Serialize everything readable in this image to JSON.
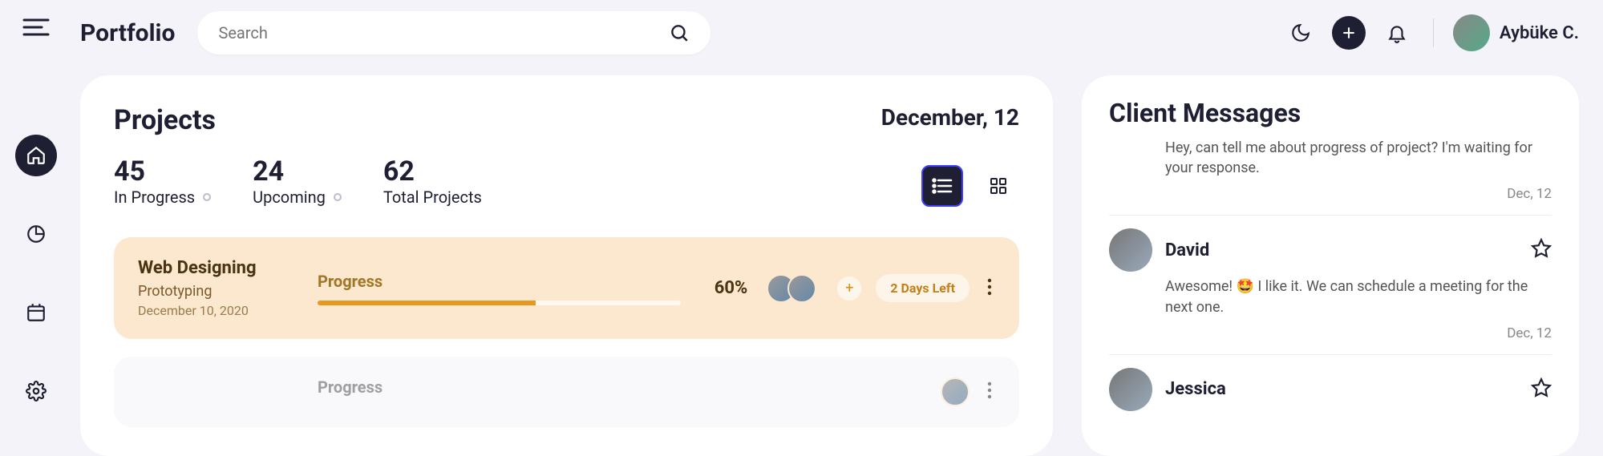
{
  "page_title": "Portfolio",
  "search_placeholder": "Search",
  "user": {
    "name": "Aybüke C."
  },
  "projects": {
    "heading": "Projects",
    "date": "December, 12",
    "stats": [
      {
        "value": "45",
        "label": "In Progress"
      },
      {
        "value": "24",
        "label": "Upcoming"
      },
      {
        "value": "62",
        "label": "Total Projects"
      }
    ],
    "rows": [
      {
        "title": "Web Designing",
        "subtitle": "Prototyping",
        "date": "December 10, 2020",
        "progress_label": "Progress",
        "percent_text": "60%",
        "percent": 60,
        "days_left": "2 Days Left",
        "accent": "#e8971f",
        "bg": "#fbe8ce"
      }
    ],
    "ghost_progress_label": "Progress"
  },
  "messages": {
    "heading": "Client Messages",
    "items": [
      {
        "partial_top": true,
        "name": "",
        "body": "Hey, can tell me about progress of project? I'm waiting for your response.",
        "date": "Dec, 12"
      },
      {
        "name": "David",
        "body": "Awesome! 🤩 I like it. We can schedule a meeting for the next one.",
        "date": "Dec, 12"
      },
      {
        "partial_bottom": true,
        "name": "Jessica",
        "body": "",
        "date": ""
      }
    ]
  }
}
